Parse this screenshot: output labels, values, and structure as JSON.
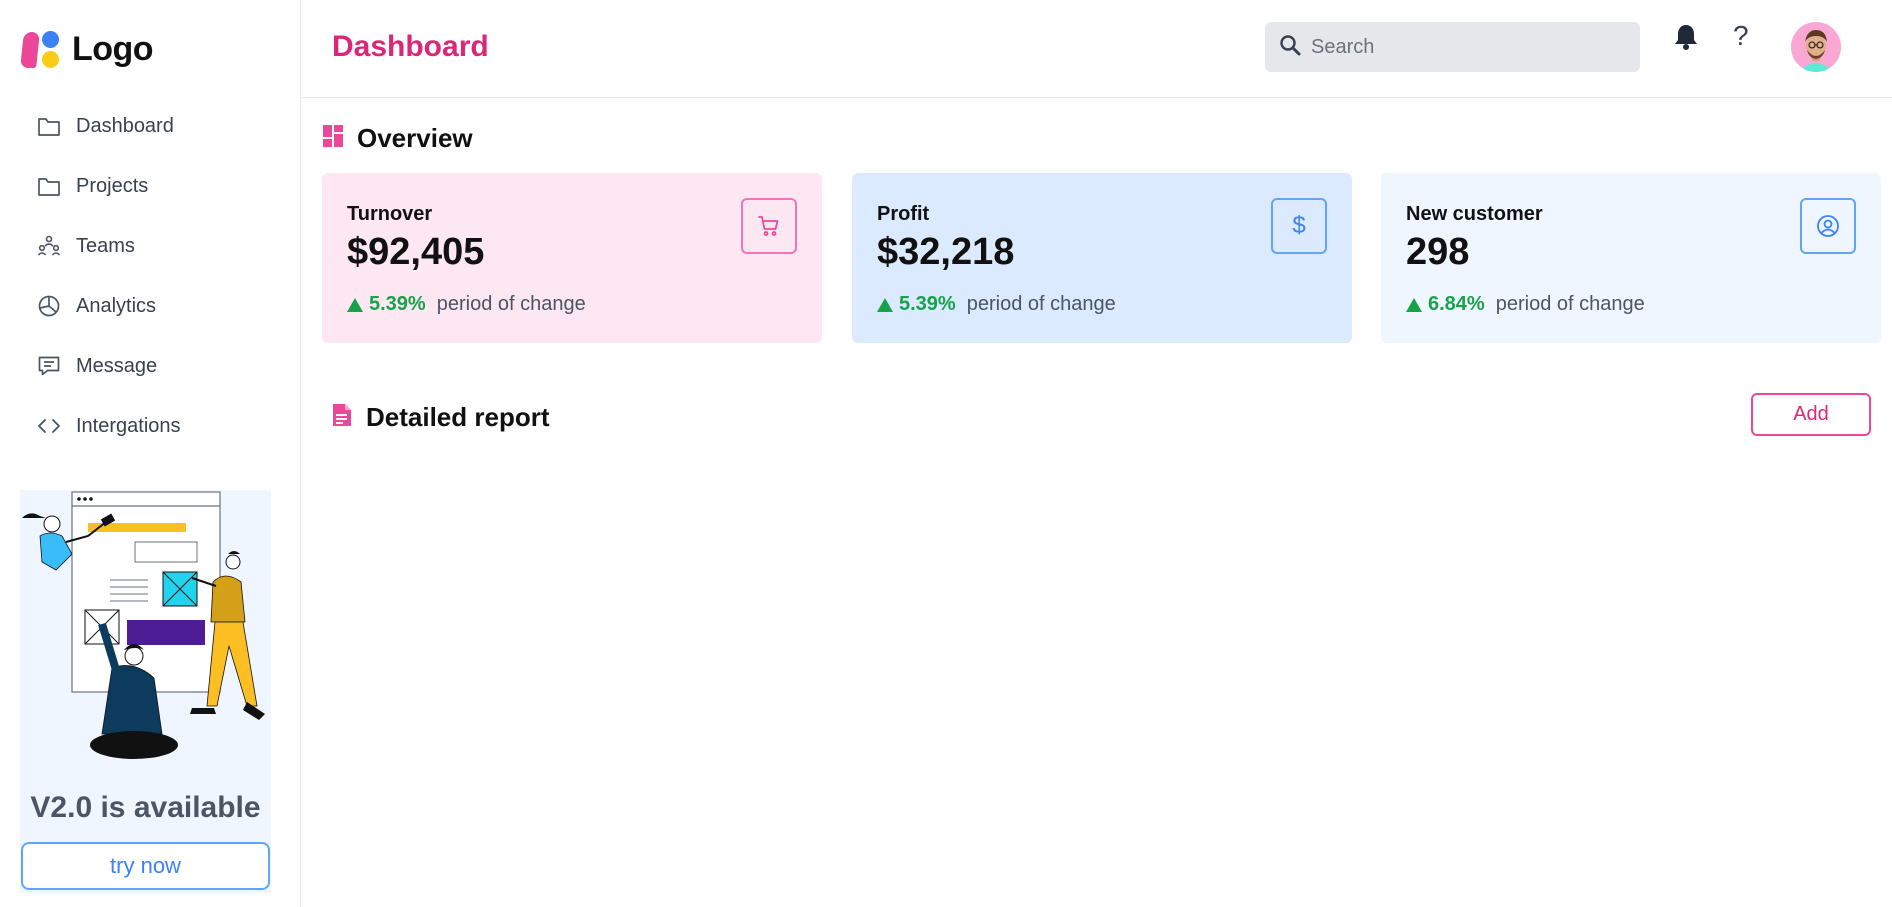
{
  "app": {
    "logo_text": "Logo"
  },
  "sidebar": {
    "items": [
      {
        "label": "Dashboard",
        "icon": "folder-icon"
      },
      {
        "label": "Projects",
        "icon": "folder-icon"
      },
      {
        "label": "Teams",
        "icon": "teams-icon"
      },
      {
        "label": "Analytics",
        "icon": "pie-chart-icon"
      },
      {
        "label": "Message",
        "icon": "message-icon"
      },
      {
        "label": "Intergations",
        "icon": "code-icon"
      }
    ],
    "promo": {
      "title": "V2.0 is available",
      "button_label": "try now"
    }
  },
  "header": {
    "title": "Dashboard",
    "search_placeholder": "Search",
    "help_label": "?"
  },
  "overview": {
    "title": "Overview",
    "cards": [
      {
        "label": "Turnover",
        "value": "$92,405",
        "change": "5.39%",
        "change_desc": "period of change",
        "icon": "cart-icon"
      },
      {
        "label": "Profit",
        "value": "$32,218",
        "change": "5.39%",
        "change_desc": "period of change",
        "icon": "dollar-icon",
        "icon_glyph": "$"
      },
      {
        "label": "New customer",
        "value": "298",
        "change": "6.84%",
        "change_desc": "period of change",
        "icon": "user-circle-icon"
      }
    ]
  },
  "report": {
    "title": "Detailed report",
    "add_label": "Add"
  },
  "colors": {
    "brand_pink": "#db2777",
    "accent_blue": "#3b82f6",
    "positive_green": "#16a34a"
  }
}
